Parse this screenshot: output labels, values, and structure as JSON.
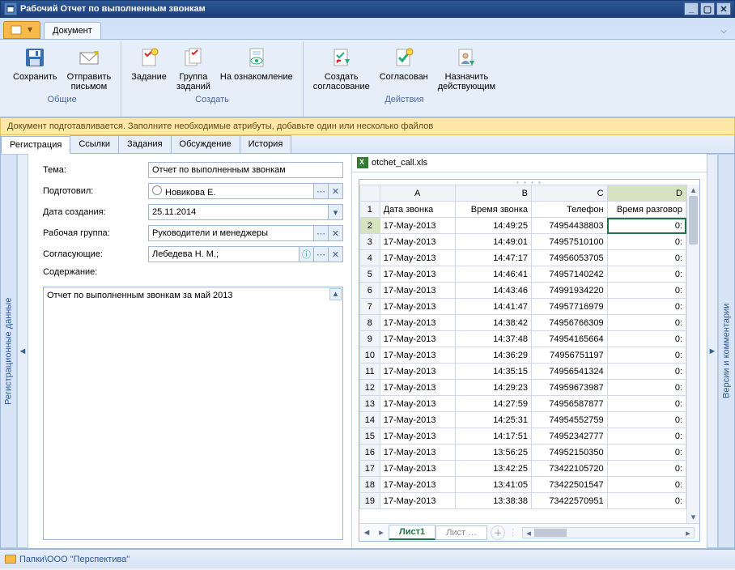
{
  "window": {
    "title": "Рабочий Отчет по выполненным звонкам"
  },
  "ribbon": {
    "tab": "Документ",
    "groups": {
      "general": {
        "title": "Общие",
        "save": "Сохранить",
        "sendmail": "Отправить\nписьмом"
      },
      "create": {
        "title": "Создать",
        "task": "Задание",
        "taskgroup": "Группа\nзаданий",
        "review": "На ознакомление"
      },
      "actions": {
        "title": "Действия",
        "approval": "Создать\nсогласование",
        "approved": "Согласован",
        "assign": "Назначить\nдействующим"
      }
    }
  },
  "infobar": "Документ подготавливается. Заполните необходимые атрибуты, добавьте один или несколько файлов",
  "tabs": {
    "reg": "Регистрация",
    "links": "Ссылки",
    "tasks": "Задания",
    "discuss": "Обсуждение",
    "history": "История"
  },
  "form": {
    "topic_lbl": "Тема:",
    "topic_val": "Отчет по выполненным звонкам",
    "author_lbl": "Подготовил:",
    "author_val": "Новикова Е.",
    "date_lbl": "Дата создания:",
    "date_val": "25.11.2014",
    "group_lbl": "Рабочая группа:",
    "group_val": "Руководители и менеджеры",
    "approvers_lbl": "Согласующие:",
    "approvers_val": "Лебедева Н. М.;",
    "content_lbl": "Содержание:",
    "content_val": "Отчет по выполненным звонкам за май 2013"
  },
  "file": {
    "name": "otchet_call.xls",
    "sheet_active": "Лист1",
    "sheet_dim": "Лист  …"
  },
  "sheet": {
    "cols": [
      "A",
      "B",
      "C",
      "D"
    ],
    "headers": [
      "Дата звонка",
      "Время звонка",
      "Телефон",
      "Время разговор"
    ],
    "rows": [
      [
        "17-May-2013",
        "14:49:25",
        "74954438803",
        "0:"
      ],
      [
        "17-May-2013",
        "14:49:01",
        "74957510100",
        "0:"
      ],
      [
        "17-May-2013",
        "14:47:17",
        "74956053705",
        "0:"
      ],
      [
        "17-May-2013",
        "14:46:41",
        "74957140242",
        "0:"
      ],
      [
        "17-May-2013",
        "14:43:46",
        "74991934220",
        "0:"
      ],
      [
        "17-May-2013",
        "14:41:47",
        "74957716979",
        "0:"
      ],
      [
        "17-May-2013",
        "14:38:42",
        "74956766309",
        "0:"
      ],
      [
        "17-May-2013",
        "14:37:48",
        "74954165664",
        "0:"
      ],
      [
        "17-May-2013",
        "14:36:29",
        "74956751197",
        "0:"
      ],
      [
        "17-May-2013",
        "14:35:15",
        "74956541324",
        "0:"
      ],
      [
        "17-May-2013",
        "14:29:23",
        "74959673987",
        "0:"
      ],
      [
        "17-May-2013",
        "14:27:59",
        "74956587877",
        "0:"
      ],
      [
        "17-May-2013",
        "14:25:31",
        "74954552759",
        "0:"
      ],
      [
        "17-May-2013",
        "14:17:51",
        "74952342777",
        "0:"
      ],
      [
        "17-May-2013",
        "13:56:25",
        "74952150350",
        "0:"
      ],
      [
        "17-May-2013",
        "13:42:25",
        "73422105720",
        "0:"
      ],
      [
        "17-May-2013",
        "13:41:05",
        "73422501547",
        "0:"
      ],
      [
        "17-May-2013",
        "13:38:38",
        "73422570951",
        "0:"
      ]
    ]
  },
  "side": {
    "left": "Регистрационные данные",
    "right": "Версии и комментарии"
  },
  "status": "Папки\\ООО \"Перспектива\""
}
